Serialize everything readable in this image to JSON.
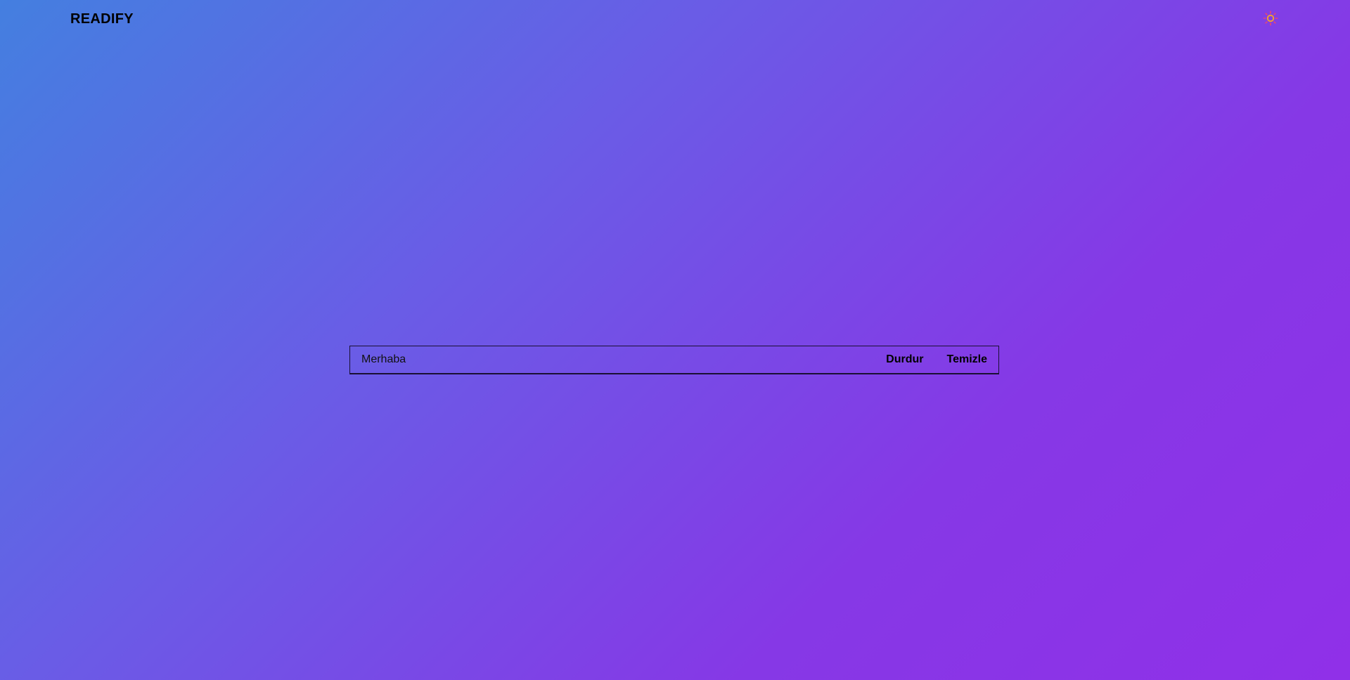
{
  "app": {
    "title": "READIFY"
  },
  "header": {
    "theme_icon": "sun-icon",
    "theme_icon_color": "#f5a623"
  },
  "reader": {
    "text": "Merhaba",
    "stop_label": "Durdur",
    "clear_label": "Temizle"
  },
  "colors": {
    "gradient_start": "#447fe0",
    "gradient_mid": "#6a5ce6",
    "gradient_end": "#9030e8",
    "text": "#000000"
  }
}
